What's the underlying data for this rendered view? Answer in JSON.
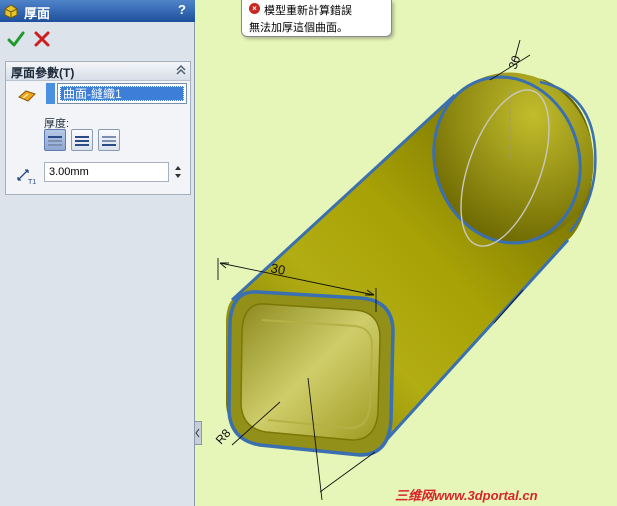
{
  "panel": {
    "title": "厚面",
    "help_label": "?",
    "ok_icon": "check-icon",
    "cancel_icon": "x-icon",
    "group": {
      "title": "厚面參數(T)",
      "selected_face": "曲面-縫織1",
      "thickness_label": "厚度:",
      "side_options": [
        "side1",
        "both-sides",
        "side2"
      ],
      "active_side": "side1",
      "thickness_value": "3.00mm"
    }
  },
  "tooltip": {
    "title": "模型重新計算錯誤",
    "message": "無法加厚這個曲面。"
  },
  "model": {
    "dimension_top": "30",
    "dimension_side": "30",
    "radius_label": "R8"
  },
  "watermark": "三维网www.3dportal.cn",
  "colors": {
    "viewport_bg": "#e6f5b8",
    "model_body": "#a5a000",
    "edge_highlight": "#3a6fb0",
    "error_red": "#c8271e",
    "watermark_red": "#d8252b"
  }
}
